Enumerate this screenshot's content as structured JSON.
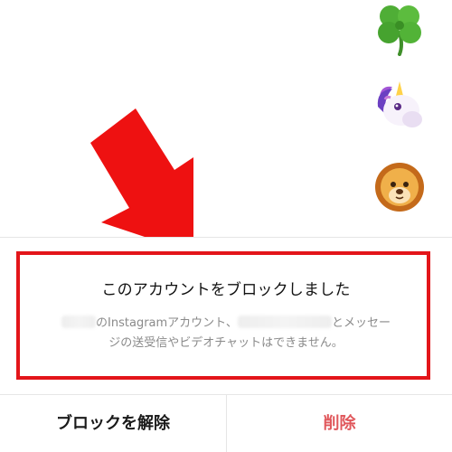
{
  "reactions": [
    {
      "icon": "four-leaf-clover-icon"
    },
    {
      "icon": "unicorn-icon"
    },
    {
      "icon": "lion-icon"
    }
  ],
  "dialog": {
    "title": "このアカウントをブロックしました",
    "desc_part1": "のInstagramアカウント、",
    "desc_part2": "とメッセー",
    "desc_line2": "ジの送受信やビデオチャットはできません。"
  },
  "actions": {
    "unblock_label": "ブロックを解除",
    "delete_label": "削除"
  },
  "colors": {
    "highlight": "#e3151a",
    "delete_text": "#e0575b",
    "description_text": "#8a8a8a"
  }
}
